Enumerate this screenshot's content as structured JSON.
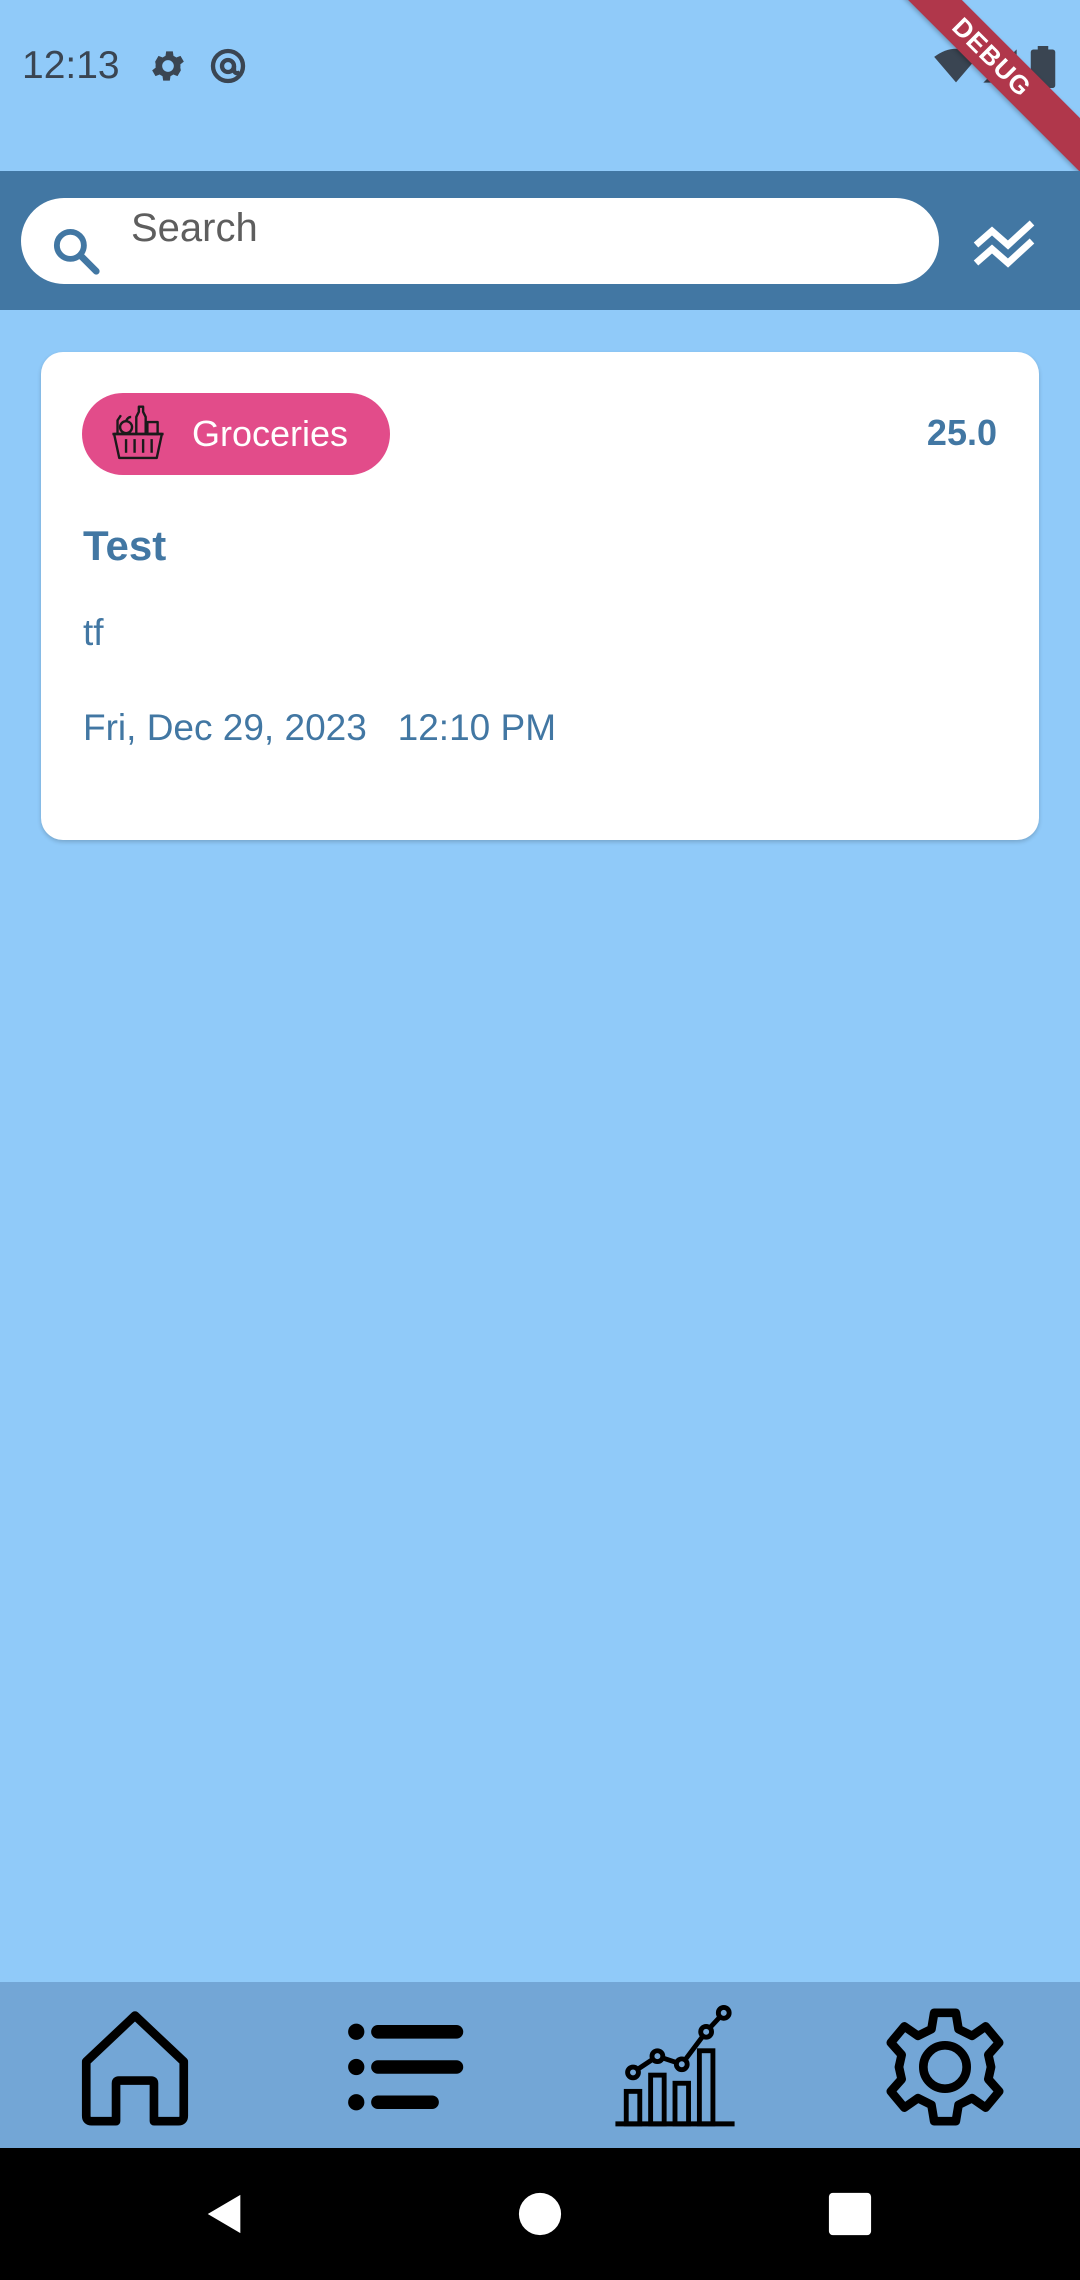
{
  "status_bar": {
    "time": "12:13",
    "icons": [
      "settings-gear-icon",
      "at-sign-icon",
      "wifi-icon",
      "signal-icon",
      "battery-icon"
    ]
  },
  "debug_banner": "DEBUG",
  "app_bar": {
    "search_placeholder": "Search",
    "sort_icon": "double-chevron-up-icon"
  },
  "transactions": [
    {
      "category": "Groceries",
      "category_icon": "grocery-basket-icon",
      "category_color": "#E24C8A",
      "amount": "25.0",
      "title": "Test",
      "note": "tf",
      "datetime": "Fri, Dec 29, 2023   12:10 PM"
    }
  ],
  "bottom_nav": {
    "items": [
      "home-icon",
      "list-icon",
      "statistics-chart-icon",
      "settings-icon"
    ]
  },
  "system_nav": [
    "back-icon",
    "home-circle-icon",
    "recents-square-icon"
  ],
  "colors": {
    "background": "#90CAF9",
    "app_bar": "#4277A3",
    "bottom_nav": "#73A6D6",
    "accent_text": "#4277A3"
  }
}
